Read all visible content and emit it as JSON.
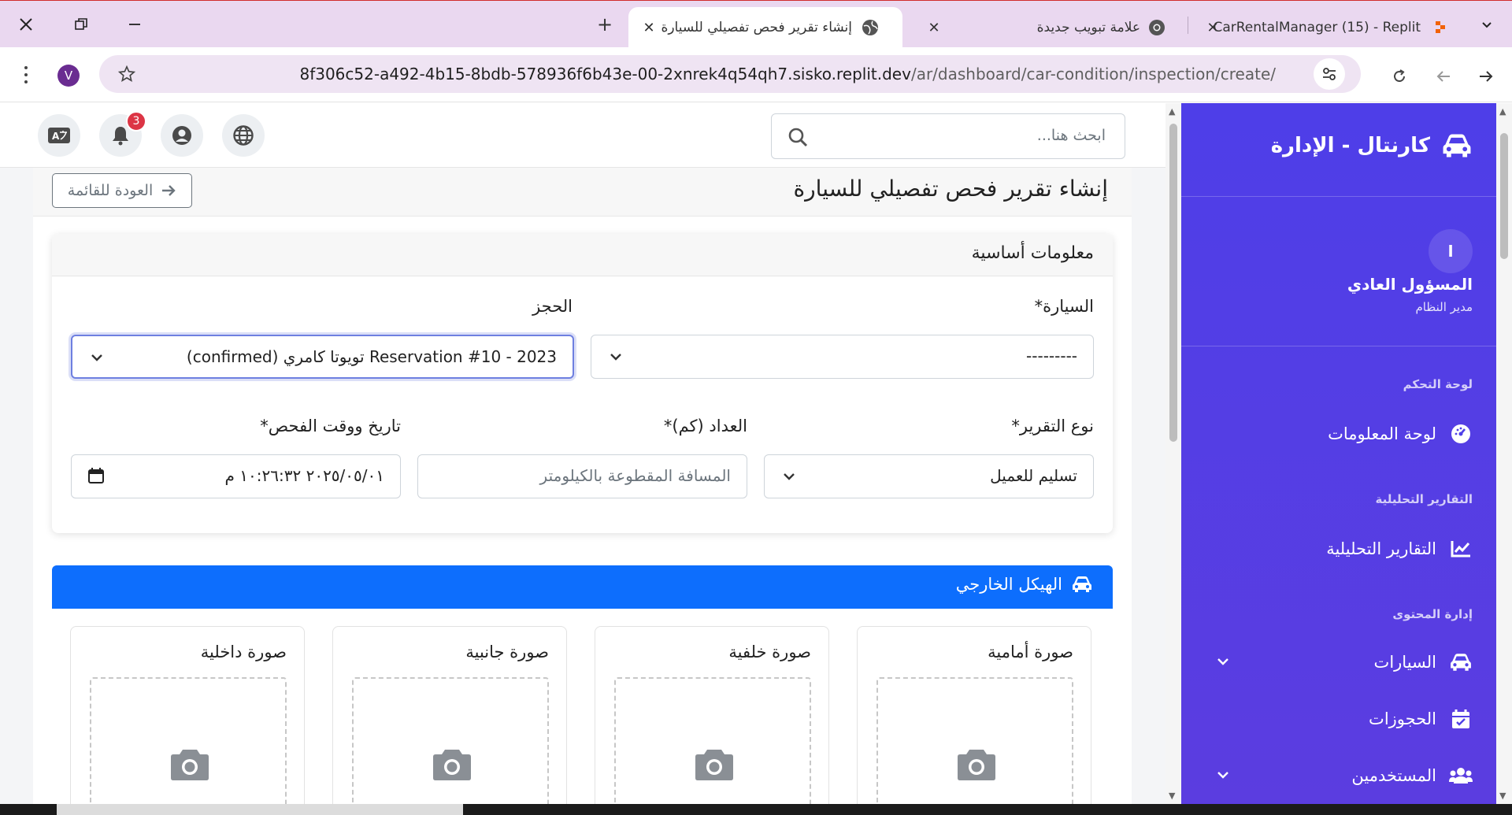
{
  "browser": {
    "tabs": [
      {
        "title": "CarRentalManager (15) - Replit",
        "favicon": "replit-icon"
      },
      {
        "title": "علامة تبويب جديدة",
        "favicon": "chrome-icon"
      },
      {
        "title": "إنشاء تقرير فحص تفصيلي للسيارة",
        "favicon": "globe-icon",
        "active": true
      }
    ],
    "new_tab": "+",
    "url_host": "8f306c52-a492-4b15-8bdb-578936f6b43e-00-2xnrek4q54qh7.sisko.replit.dev",
    "url_path": "/ar/dashboard/car-condition/inspection/create/",
    "profile_initial": "V"
  },
  "sidebar": {
    "brand": "كارنتال - الإدارة",
    "user_initial": "ا",
    "user_name": "المسؤول العادي",
    "user_role": "مدير النظام",
    "sections": [
      {
        "title": "لوحة التحكم"
      },
      {
        "title": "التقارير التحليلية"
      },
      {
        "title": "إدارة المحتوى"
      }
    ],
    "items": [
      {
        "label": "لوحة المعلومات",
        "icon": "dashboard-gauge-icon"
      },
      {
        "label": "التقارير التحليلية",
        "icon": "line-chart-icon"
      },
      {
        "label": "السيارات",
        "icon": "car-icon",
        "expandable": true
      },
      {
        "label": "الحجوزات",
        "icon": "calendar-icon"
      },
      {
        "label": "المستخدمين",
        "icon": "users-icon",
        "expandable": true
      }
    ]
  },
  "topnav": {
    "search_placeholder": "ابحث هنا...",
    "notifications_count": "3",
    "buttons": [
      "language-icon",
      "notifications-bell-icon",
      "user-account-icon",
      "globe-icon"
    ]
  },
  "page": {
    "title": "إنشاء تقرير فحص تفصيلي للسيارة",
    "back_label": "العودة للقائمة"
  },
  "basic_info": {
    "title": "معلومات أساسية",
    "car_label": "السيارة*",
    "car_value": "---------",
    "booking_label": "الحجز",
    "booking_value": "Reservation #10 - 2023 تويوتا كامري (confirmed)",
    "report_type_label": "نوع التقرير*",
    "report_type_value": "تسليم للعميل",
    "odometer_label": "العداد (كم)*",
    "odometer_placeholder": "المسافة المقطوعة بالكيلومتر",
    "datetime_label": "تاريخ ووقت الفحص*",
    "datetime_value": "٢٠٢٥/٠٥/٠١ ١٠:٢٦:٣٢ م"
  },
  "exterior": {
    "title": "الهيكل الخارجي",
    "photos": [
      {
        "label": "صورة أمامية"
      },
      {
        "label": "صورة خلفية"
      },
      {
        "label": "صورة جانبية"
      },
      {
        "label": "صورة داخلية"
      }
    ]
  },
  "colors": {
    "tabbar_bg": "#ead8f0",
    "sidebar_bg": "#4e3ee8",
    "primary": "#0d6efd",
    "badge": "#dc3545"
  }
}
